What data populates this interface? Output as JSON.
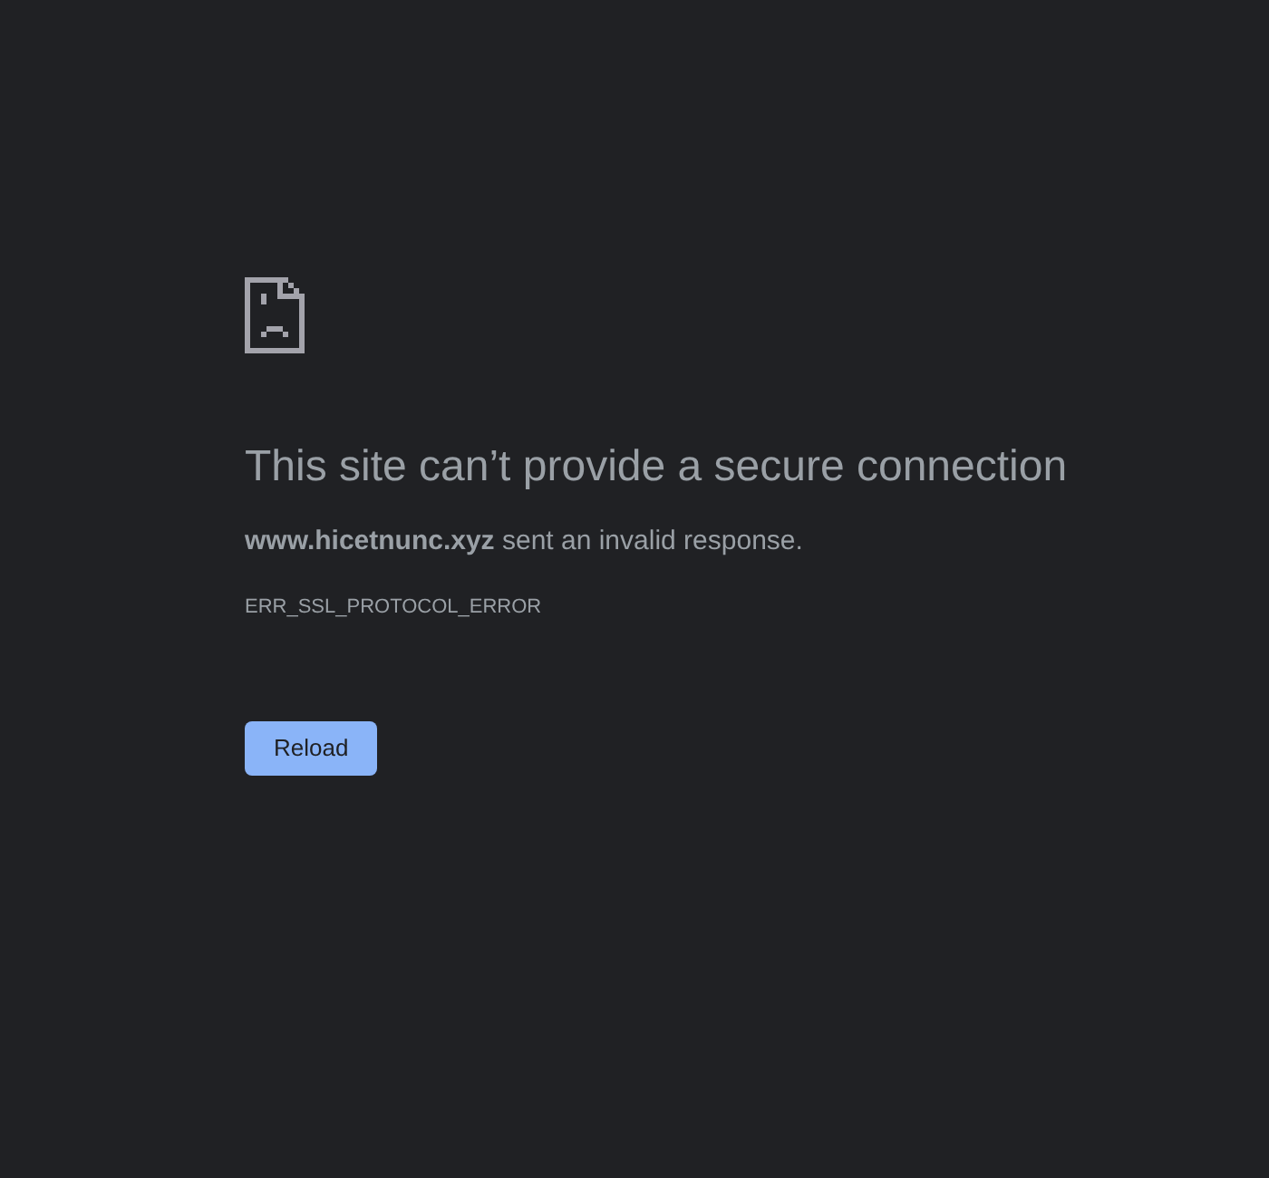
{
  "title": "This site can’t provide a secure connection",
  "message": "**www.hicetnunc.xyz** sent an invalid response.",
  "error_code": "ERR_SSL_PROTOCOL_ERROR",
  "button": {
    "label": "Reload"
  }
}
